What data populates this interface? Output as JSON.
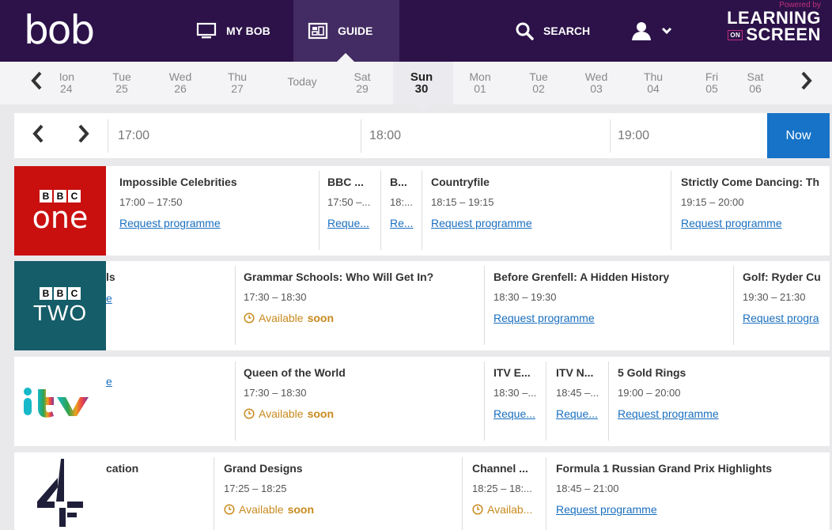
{
  "header": {
    "logo": "bob",
    "nav": [
      {
        "label": "MY BOB",
        "icon": "monitor-icon"
      },
      {
        "label": "GUIDE",
        "icon": "guide-icon"
      },
      {
        "label": "SEARCH",
        "icon": "search-icon"
      }
    ],
    "user_icon": "user-icon",
    "partner": {
      "powered_by": "Powered by",
      "line1": "LEARNING",
      "on": "ON",
      "line2": "SCREEN"
    }
  },
  "days": [
    {
      "name": "Mon",
      "date": "24"
    },
    {
      "name": "Tue",
      "date": "25"
    },
    {
      "name": "Wed",
      "date": "26"
    },
    {
      "name": "Thu",
      "date": "27"
    },
    {
      "name": "Today",
      "date": ""
    },
    {
      "name": "Sat",
      "date": "29"
    },
    {
      "name": "Sun",
      "date": "30"
    },
    {
      "name": "Mon",
      "date": "01"
    },
    {
      "name": "Tue",
      "date": "02"
    },
    {
      "name": "Wed",
      "date": "03"
    },
    {
      "name": "Thu",
      "date": "04"
    },
    {
      "name": "Fri",
      "date": "05"
    },
    {
      "name": "Sat",
      "date": "06"
    }
  ],
  "timebar": {
    "times": [
      "17:00",
      "18:00",
      "19:00"
    ],
    "now_label": "Now"
  },
  "channels": [
    {
      "name": "BBC One",
      "logo_top": "BBC",
      "logo_text": "one",
      "color": "#c9100f",
      "programmes": [
        {
          "title": "Impossible Celebrities",
          "time": "17:00 – 17:50",
          "action": "Request programme"
        },
        {
          "title": "BBC ...",
          "time": "17:50 –...",
          "action": "Reque..."
        },
        {
          "title": "B...",
          "time": "18:...",
          "action": "Re..."
        },
        {
          "title": "Countryfile",
          "time": "18:15 – 19:15",
          "action": "Request programme"
        },
        {
          "title": "Strictly Come Dancing: Th",
          "time": "19:15 – 20:00",
          "action": "Request programme"
        }
      ]
    },
    {
      "name": "BBC Two",
      "logo_top": "BBC",
      "logo_text": "TWO",
      "color": "#155d68",
      "programmes": [
        {
          "title": "ls",
          "time": "",
          "action": "e"
        },
        {
          "title": "Grammar Schools: Who Will Get In?",
          "time": "17:30 – 18:30",
          "action": "Available",
          "action_bold": "soon"
        },
        {
          "title": "Before Grenfell: A Hidden History",
          "time": "18:30 – 19:30",
          "action": "Request programme"
        },
        {
          "title": "Golf: Ryder Cu",
          "time": "19:30 – 21:30",
          "action": "Request progra"
        }
      ]
    },
    {
      "name": "ITV",
      "programmes": [
        {
          "title": "",
          "time": "",
          "action": "e"
        },
        {
          "title": "Queen of the World",
          "time": "17:30 – 18:30",
          "action": "Available",
          "action_bold": "soon"
        },
        {
          "title": "ITV E...",
          "time": "18:30 –...",
          "action": "Reque..."
        },
        {
          "title": "ITV N...",
          "time": "18:45 –...",
          "action": "Reque..."
        },
        {
          "title": "5 Gold Rings",
          "time": "19:00 – 20:00",
          "action": "Request programme"
        }
      ]
    },
    {
      "name": "Channel 4",
      "programmes": [
        {
          "title": "cation",
          "time": "",
          "action": ""
        },
        {
          "title": "Grand Designs",
          "time": "17:25 – 18:25",
          "action": "Available",
          "action_bold": "soon"
        },
        {
          "title": "Channel ...",
          "time": "18:25 – 18:...",
          "action": "Availab..."
        },
        {
          "title": "Formula 1 Russian Grand Prix Highlights",
          "time": "18:45 – 21:00",
          "action": "Request programme"
        }
      ]
    }
  ],
  "colors": {
    "header_bg": "#2c1249",
    "accent_blue": "#1673c7",
    "link": "#1a6fbf",
    "available": "#c88a1e"
  }
}
